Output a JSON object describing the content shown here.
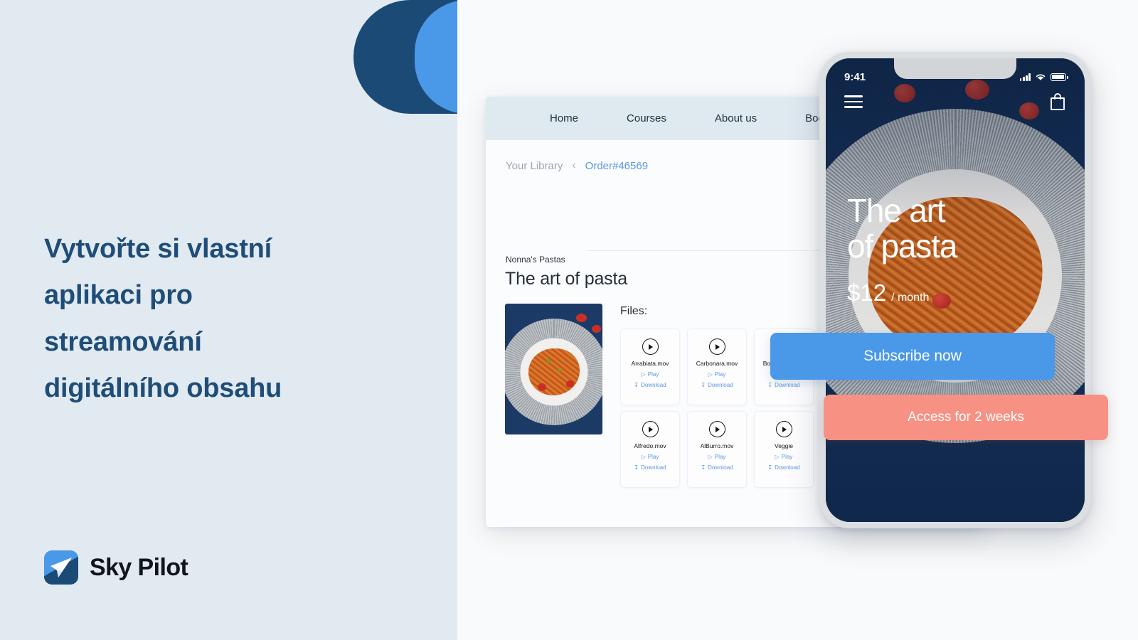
{
  "left": {
    "headline_lines": [
      "Vytvořte si vlastní",
      "aplikaci pro",
      "streamování",
      "digitálního obsahu"
    ],
    "logo_text": "Sky Pilot",
    "colors": {
      "background": "#e1eaf1",
      "headline": "#1f4d77",
      "circle_dark": "#1c4a77",
      "circle_blue": "#4a98e8"
    }
  },
  "browser": {
    "nav_items": [
      {
        "label": "Home"
      },
      {
        "label": "Courses"
      },
      {
        "label": "About us"
      },
      {
        "label": "Books"
      }
    ],
    "breadcrumb": {
      "root": "Your Library",
      "separator": "‹",
      "current": "Order#46569"
    },
    "course": {
      "eyebrow": "Nonna's Pastas",
      "title": "The art of pasta"
    },
    "files_label": "Files:",
    "file_actions": {
      "play": "Play",
      "download": "Download",
      "play_icon": "play-triangle-icon",
      "download_icon": "download-arrow-icon"
    },
    "files": [
      {
        "name": "Arrabiata.mov"
      },
      {
        "name": "Carbonara.mov"
      },
      {
        "name": "Bolognese.mov"
      },
      {
        "name": "Alfredo.mov"
      },
      {
        "name": "AlBurro.mov"
      },
      {
        "name": "Veggie"
      }
    ],
    "colors": {
      "nav_background": "#dfe9f0",
      "link": "#5d97e0",
      "card_background": "#fbfcfd"
    }
  },
  "phone": {
    "status": {
      "time": "9:41",
      "signal_icon": "signal-bars-icon",
      "wifi_icon": "wifi-icon",
      "battery_icon": "battery-full-icon"
    },
    "menu_icon": "hamburger-menu-icon",
    "bag_icon": "shopping-bag-icon",
    "hero": {
      "title_line1": "The art",
      "title_line2": "of pasta",
      "price_amount": "$12",
      "price_period": "/ month"
    },
    "buttons": {
      "subscribe": "Subscribe now",
      "access": "Access for 2 weeks"
    },
    "colors": {
      "subscribe_background": "#4a98e8",
      "access_background": "#f79183",
      "frame": "#dcdfe2"
    }
  }
}
